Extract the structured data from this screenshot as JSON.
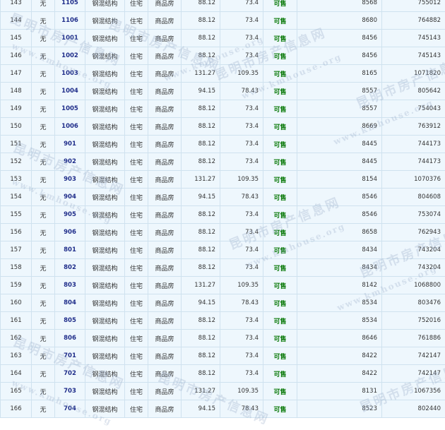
{
  "columns": [
    "seq",
    "floor_note",
    "room",
    "structure",
    "usage",
    "type",
    "area_total",
    "area_inner",
    "status",
    "unit_price",
    "total_price"
  ],
  "rows": [
    {
      "seq": "143",
      "floor_note": "无",
      "room": "1105",
      "structure": "钢混结构",
      "usage": "住宅",
      "type": "商品房",
      "area_total": "88.12",
      "area_inner": "73.4",
      "status": "可售",
      "unit_price": "8568",
      "total_price": "755012"
    },
    {
      "seq": "144",
      "floor_note": "无",
      "room": "1106",
      "structure": "钢混结构",
      "usage": "住宅",
      "type": "商品房",
      "area_total": "88.12",
      "area_inner": "73.4",
      "status": "可售",
      "unit_price": "8680",
      "total_price": "764882"
    },
    {
      "seq": "145",
      "floor_note": "无",
      "room": "1001",
      "structure": "钢混结构",
      "usage": "住宅",
      "type": "商品房",
      "area_total": "88.12",
      "area_inner": "73.4",
      "status": "可售",
      "unit_price": "8456",
      "total_price": "745143"
    },
    {
      "seq": "146",
      "floor_note": "无",
      "room": "1002",
      "structure": "钢混结构",
      "usage": "住宅",
      "type": "商品房",
      "area_total": "88.12",
      "area_inner": "73.4",
      "status": "可售",
      "unit_price": "8456",
      "total_price": "745143"
    },
    {
      "seq": "147",
      "floor_note": "无",
      "room": "1003",
      "structure": "钢混结构",
      "usage": "住宅",
      "type": "商品房",
      "area_total": "131.27",
      "area_inner": "109.35",
      "status": "可售",
      "unit_price": "8165",
      "total_price": "1071820"
    },
    {
      "seq": "148",
      "floor_note": "无",
      "room": "1004",
      "structure": "钢混结构",
      "usage": "住宅",
      "type": "商品房",
      "area_total": "94.15",
      "area_inner": "78.43",
      "status": "可售",
      "unit_price": "8557",
      "total_price": "805642"
    },
    {
      "seq": "149",
      "floor_note": "无",
      "room": "1005",
      "structure": "钢混结构",
      "usage": "住宅",
      "type": "商品房",
      "area_total": "88.12",
      "area_inner": "73.4",
      "status": "可售",
      "unit_price": "8557",
      "total_price": "754043"
    },
    {
      "seq": "150",
      "floor_note": "无",
      "room": "1006",
      "structure": "钢混结构",
      "usage": "住宅",
      "type": "商品房",
      "area_total": "88.12",
      "area_inner": "73.4",
      "status": "可售",
      "unit_price": "8669",
      "total_price": "763912"
    },
    {
      "seq": "151",
      "floor_note": "无",
      "room": "901",
      "structure": "钢混结构",
      "usage": "住宅",
      "type": "商品房",
      "area_total": "88.12",
      "area_inner": "73.4",
      "status": "可售",
      "unit_price": "8445",
      "total_price": "744173"
    },
    {
      "seq": "152",
      "floor_note": "无",
      "room": "902",
      "structure": "钢混结构",
      "usage": "住宅",
      "type": "商品房",
      "area_total": "88.12",
      "area_inner": "73.4",
      "status": "可售",
      "unit_price": "8445",
      "total_price": "744173"
    },
    {
      "seq": "153",
      "floor_note": "无",
      "room": "903",
      "structure": "钢混结构",
      "usage": "住宅",
      "type": "商品房",
      "area_total": "131.27",
      "area_inner": "109.35",
      "status": "可售",
      "unit_price": "8154",
      "total_price": "1070376"
    },
    {
      "seq": "154",
      "floor_note": "无",
      "room": "904",
      "structure": "钢混结构",
      "usage": "住宅",
      "type": "商品房",
      "area_total": "94.15",
      "area_inner": "78.43",
      "status": "可售",
      "unit_price": "8546",
      "total_price": "804608"
    },
    {
      "seq": "155",
      "floor_note": "无",
      "room": "905",
      "structure": "钢混结构",
      "usage": "住宅",
      "type": "商品房",
      "area_total": "88.12",
      "area_inner": "73.4",
      "status": "可售",
      "unit_price": "8546",
      "total_price": "753074"
    },
    {
      "seq": "156",
      "floor_note": "无",
      "room": "906",
      "structure": "钢混结构",
      "usage": "住宅",
      "type": "商品房",
      "area_total": "88.12",
      "area_inner": "73.4",
      "status": "可售",
      "unit_price": "8658",
      "total_price": "762943"
    },
    {
      "seq": "157",
      "floor_note": "无",
      "room": "801",
      "structure": "钢混结构",
      "usage": "住宅",
      "type": "商品房",
      "area_total": "88.12",
      "area_inner": "73.4",
      "status": "可售",
      "unit_price": "8434",
      "total_price": "743204"
    },
    {
      "seq": "158",
      "floor_note": "无",
      "room": "802",
      "structure": "钢混结构",
      "usage": "住宅",
      "type": "商品房",
      "area_total": "88.12",
      "area_inner": "73.4",
      "status": "可售",
      "unit_price": "8434",
      "total_price": "743204"
    },
    {
      "seq": "159",
      "floor_note": "无",
      "room": "803",
      "structure": "钢混结构",
      "usage": "住宅",
      "type": "商品房",
      "area_total": "131.27",
      "area_inner": "109.35",
      "status": "可售",
      "unit_price": "8142",
      "total_price": "1068800"
    },
    {
      "seq": "160",
      "floor_note": "无",
      "room": "804",
      "structure": "钢混结构",
      "usage": "住宅",
      "type": "商品房",
      "area_total": "94.15",
      "area_inner": "78.43",
      "status": "可售",
      "unit_price": "8534",
      "total_price": "803476"
    },
    {
      "seq": "161",
      "floor_note": "无",
      "room": "805",
      "structure": "钢混结构",
      "usage": "住宅",
      "type": "商品房",
      "area_total": "88.12",
      "area_inner": "73.4",
      "status": "可售",
      "unit_price": "8534",
      "total_price": "752016"
    },
    {
      "seq": "162",
      "floor_note": "无",
      "room": "806",
      "structure": "钢混结构",
      "usage": "住宅",
      "type": "商品房",
      "area_total": "88.12",
      "area_inner": "73.4",
      "status": "可售",
      "unit_price": "8646",
      "total_price": "761886"
    },
    {
      "seq": "163",
      "floor_note": "无",
      "room": "701",
      "structure": "钢混结构",
      "usage": "住宅",
      "type": "商品房",
      "area_total": "88.12",
      "area_inner": "73.4",
      "status": "可售",
      "unit_price": "8422",
      "total_price": "742147"
    },
    {
      "seq": "164",
      "floor_note": "无",
      "room": "702",
      "structure": "钢混结构",
      "usage": "住宅",
      "type": "商品房",
      "area_total": "88.12",
      "area_inner": "73.4",
      "status": "可售",
      "unit_price": "8422",
      "total_price": "742147"
    },
    {
      "seq": "165",
      "floor_note": "无",
      "room": "703",
      "structure": "钢混结构",
      "usage": "住宅",
      "type": "商品房",
      "area_total": "131.27",
      "area_inner": "109.35",
      "status": "可售",
      "unit_price": "8131",
      "total_price": "1067356"
    },
    {
      "seq": "166",
      "floor_note": "无",
      "room": "704",
      "structure": "钢混结构",
      "usage": "住宅",
      "type": "商品房",
      "area_total": "94.15",
      "area_inner": "78.43",
      "status": "可售",
      "unit_price": "8523",
      "total_price": "802440"
    }
  ],
  "watermark": {
    "cn": "昆明市房产信息网",
    "en": "www.kmhouse.org"
  },
  "colors": {
    "cell_bg": "#eef7fd",
    "border": "#cfe2ef",
    "room_text": "#1f2d8a",
    "status_text": "#0a7a0a"
  }
}
